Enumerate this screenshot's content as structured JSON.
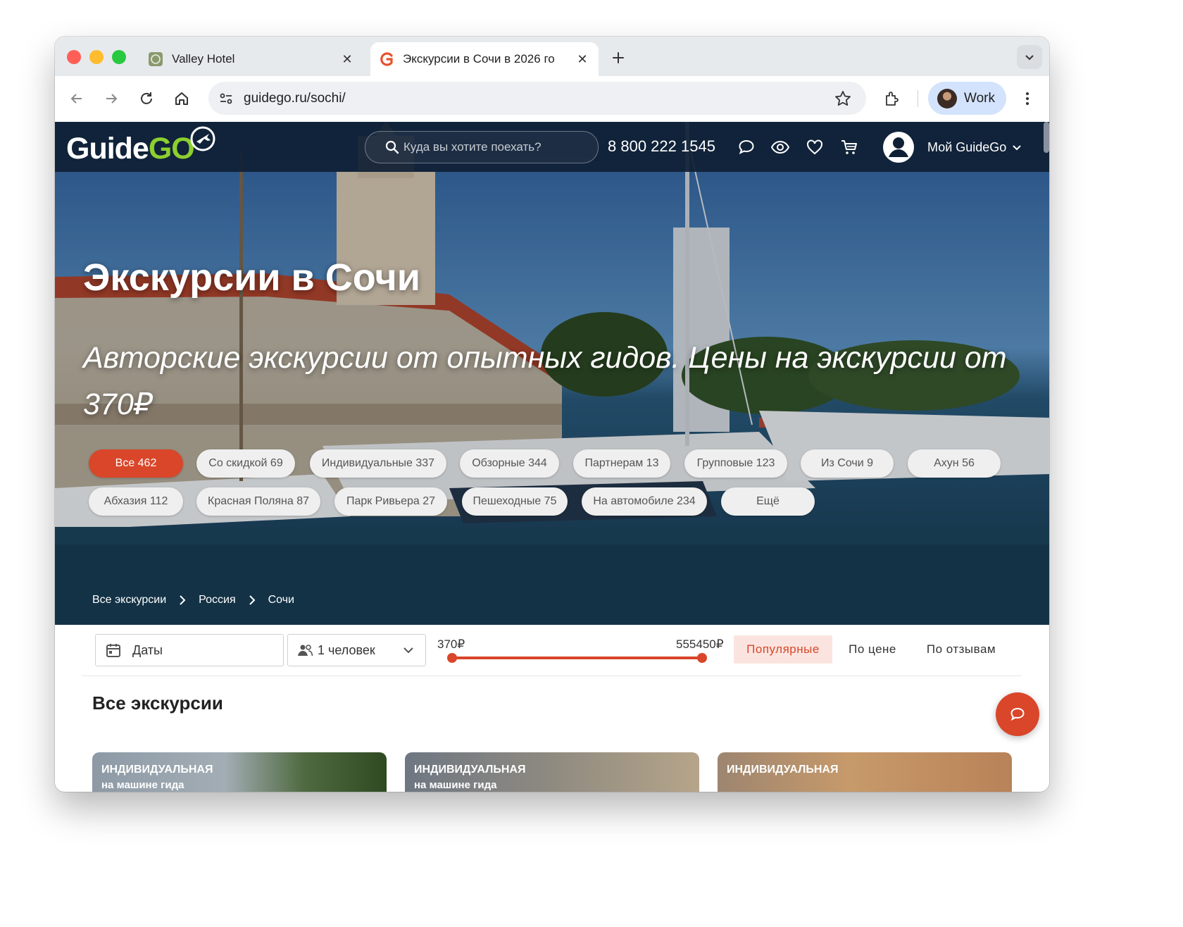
{
  "browser": {
    "tabs": [
      {
        "title": "Valley Hotel",
        "active": false
      },
      {
        "title": "Экскурсии в Сочи в 2026 го",
        "active": true
      }
    ],
    "url": "guidego.ru/sochi/",
    "profile_name": "Work"
  },
  "site": {
    "logo_part1": "Guide",
    "logo_part2": "GO",
    "search_placeholder": "Куда вы хотите поехать?",
    "phone": "8 800 222 1545",
    "account_label": "Мой GuideGo"
  },
  "hero": {
    "title": "Экскурсии в Сочи",
    "subtitle": "Авторские экскурсии от опытных гидов. Цены на экскурсии от 370₽",
    "chips": [
      {
        "label": "Все 462",
        "active": true
      },
      {
        "label": "Со скидкой 69",
        "active": false
      },
      {
        "label": "Индивидуальные 337",
        "active": false
      },
      {
        "label": "Обзорные 344",
        "active": false
      },
      {
        "label": "Партнерам 13",
        "active": false
      },
      {
        "label": "Групповые 123",
        "active": false
      },
      {
        "label": "Из Сочи 9",
        "active": false
      },
      {
        "label": "Ахун 56",
        "active": false
      },
      {
        "label": "Абхазия 112",
        "active": false
      },
      {
        "label": "Красная Поляна 87",
        "active": false
      },
      {
        "label": "Парк Ривьера 27",
        "active": false
      },
      {
        "label": "Пешеходные 75",
        "active": false
      },
      {
        "label": "На автомобиле 234",
        "active": false
      },
      {
        "label": "Ещё",
        "active": false
      }
    ],
    "breadcrumbs": [
      "Все экскурсии",
      "Россия",
      "Сочи"
    ]
  },
  "filters": {
    "dates_label": "Даты",
    "people_label": "1 человек",
    "price_min": "370₽",
    "price_max": "555450₽",
    "sort_options": [
      {
        "label": "Популярные",
        "active": true
      },
      {
        "label": "По цене",
        "active": false
      },
      {
        "label": "По отзывам",
        "active": false
      }
    ]
  },
  "listing": {
    "heading": "Все экскурсии",
    "cards": [
      {
        "type": "Индивидуальная",
        "sub": "на машине гида"
      },
      {
        "type": "Индивидуальная",
        "sub": "на машине гида"
      },
      {
        "type": "Индивидуальная",
        "sub": ""
      }
    ]
  },
  "colors": {
    "accent": "#d9462a",
    "navbar": "#0f2034",
    "logo_green": "#8ccf2f",
    "profile_chip": "#d3e3fd"
  },
  "icons": [
    "back-icon",
    "forward-icon",
    "reload-icon",
    "home-icon",
    "site-settings-icon",
    "star-icon",
    "extensions-icon",
    "more-icon",
    "search-icon",
    "chat-icon",
    "eye-icon",
    "heart-icon",
    "cart-icon",
    "user-icon",
    "calendar-icon",
    "people-icon",
    "chevron-down-icon",
    "chevron-right-icon"
  ]
}
